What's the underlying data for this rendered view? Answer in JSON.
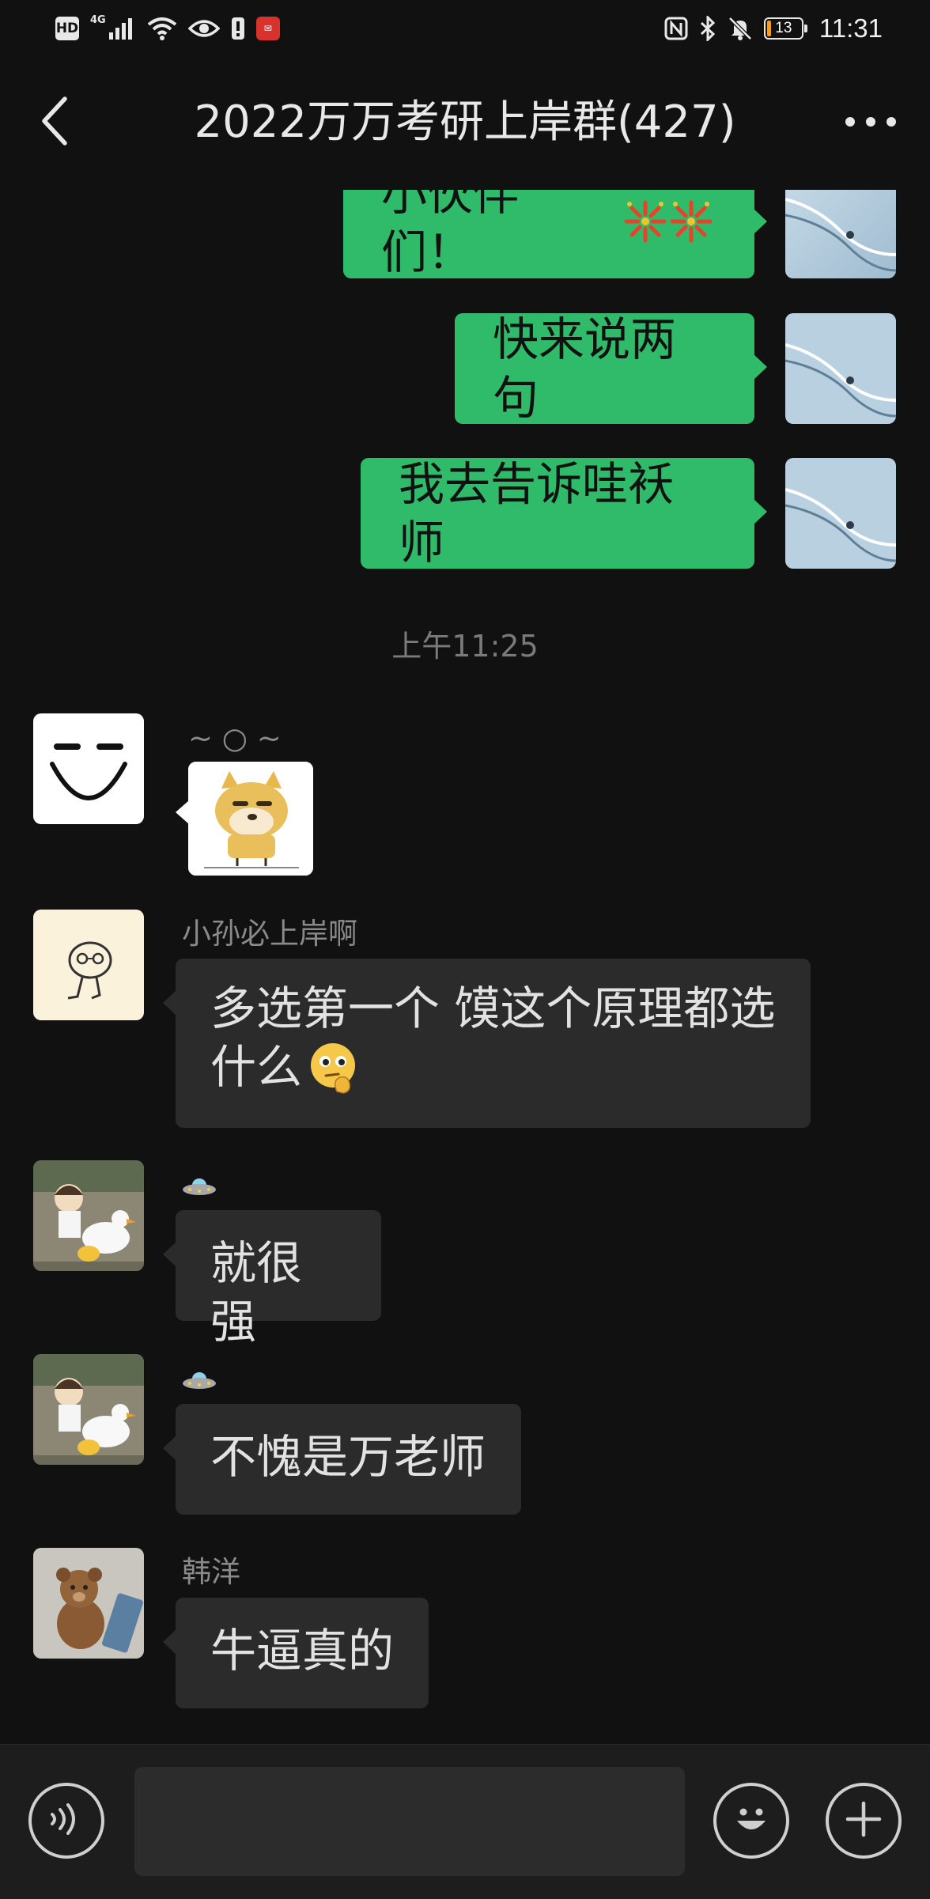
{
  "status_bar": {
    "left_icons": [
      "hd-icon",
      "signal-4g-icon",
      "wifi-icon",
      "eye-icon",
      "alert-icon",
      "app-notification-icon"
    ],
    "hd_label": "HD",
    "network_label": "4G",
    "battery_level": "13",
    "battery_fraction": 0.13,
    "time": "11:31",
    "right_icons": [
      "nfc-icon",
      "bluetooth-icon",
      "bell-muted-icon",
      "battery-icon"
    ]
  },
  "header": {
    "title": "2022万万考研上岸群(427)",
    "back_icon": "chevron-left-icon",
    "more_icon": "more-dots-icon"
  },
  "messages_outgoing": [
    {
      "text": "小伙伴们！",
      "emoji": "fireworks-icon"
    },
    {
      "text": "快来说两句"
    },
    {
      "text": "我去告诉哇袄师"
    }
  ],
  "timestamp": "上午11:25",
  "messages_incoming": [
    {
      "sender": "~ ○ ~",
      "type": "sticker",
      "sticker": "doge-sticker"
    },
    {
      "sender": "小孙必上岸啊",
      "text_line1": "多选第一个 馍这个原理都选",
      "text_line2": "什么",
      "emoji": "thinking-face-icon"
    },
    {
      "sender_icon": "ufo-icon",
      "text": "就很强"
    },
    {
      "sender_icon": "ufo-icon",
      "text": "不愧是万老师"
    },
    {
      "sender": "韩洋",
      "text": "牛逼真的"
    }
  ],
  "input_bar": {
    "voice_icon": "voice-icon",
    "input_value": "",
    "emoji_icon": "smiley-icon",
    "plus_icon": "plus-icon"
  },
  "colors": {
    "background": "#111111",
    "outgoing_bubble": "#2fbb6a",
    "incoming_bubble": "#2b2b2b",
    "input_bar": "#1d1d1d"
  }
}
